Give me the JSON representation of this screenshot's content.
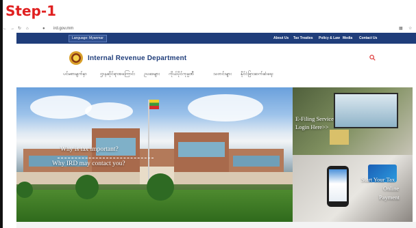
{
  "step": {
    "title": "Step-1"
  },
  "browser": {
    "url": "ird.gov.mm"
  },
  "lang": {
    "label": "Language: Myanmar"
  },
  "topnav": [
    "About Us",
    "Tax Treaties",
    "Policy & Law",
    "Media",
    "Contact Us"
  ],
  "site": {
    "name": "Internal Revenue Department"
  },
  "menu": [
    "ပင်မစာမျက်နှာ",
    "ဌာနဆိုင်ရာအကြောင်း",
    "ဥပဒေများ",
    "ကိုယ်ပိုင်ကုမ္ပဏီ",
    "သတင်းများ",
    "နိုင်ငံခြားဆက်ဆံရေး"
  ],
  "hero": {
    "link1": "Why is tax important?",
    "link2": "Why IRD may contact you?"
  },
  "panels": {
    "efiling": {
      "line1": "E-Filing Service",
      "line2": "Login Here>>"
    },
    "payment": {
      "line1": "Start Your Tax",
      "line2": "Online",
      "line3": "Payment"
    }
  },
  "colors": {
    "step": "#e02020",
    "nav": "#1f3d7a",
    "brand": "#1f3d7a"
  },
  "icons": {
    "back": "back-arrow-icon",
    "forward": "forward-arrow-icon",
    "reload": "reload-icon",
    "search": "search-icon"
  }
}
